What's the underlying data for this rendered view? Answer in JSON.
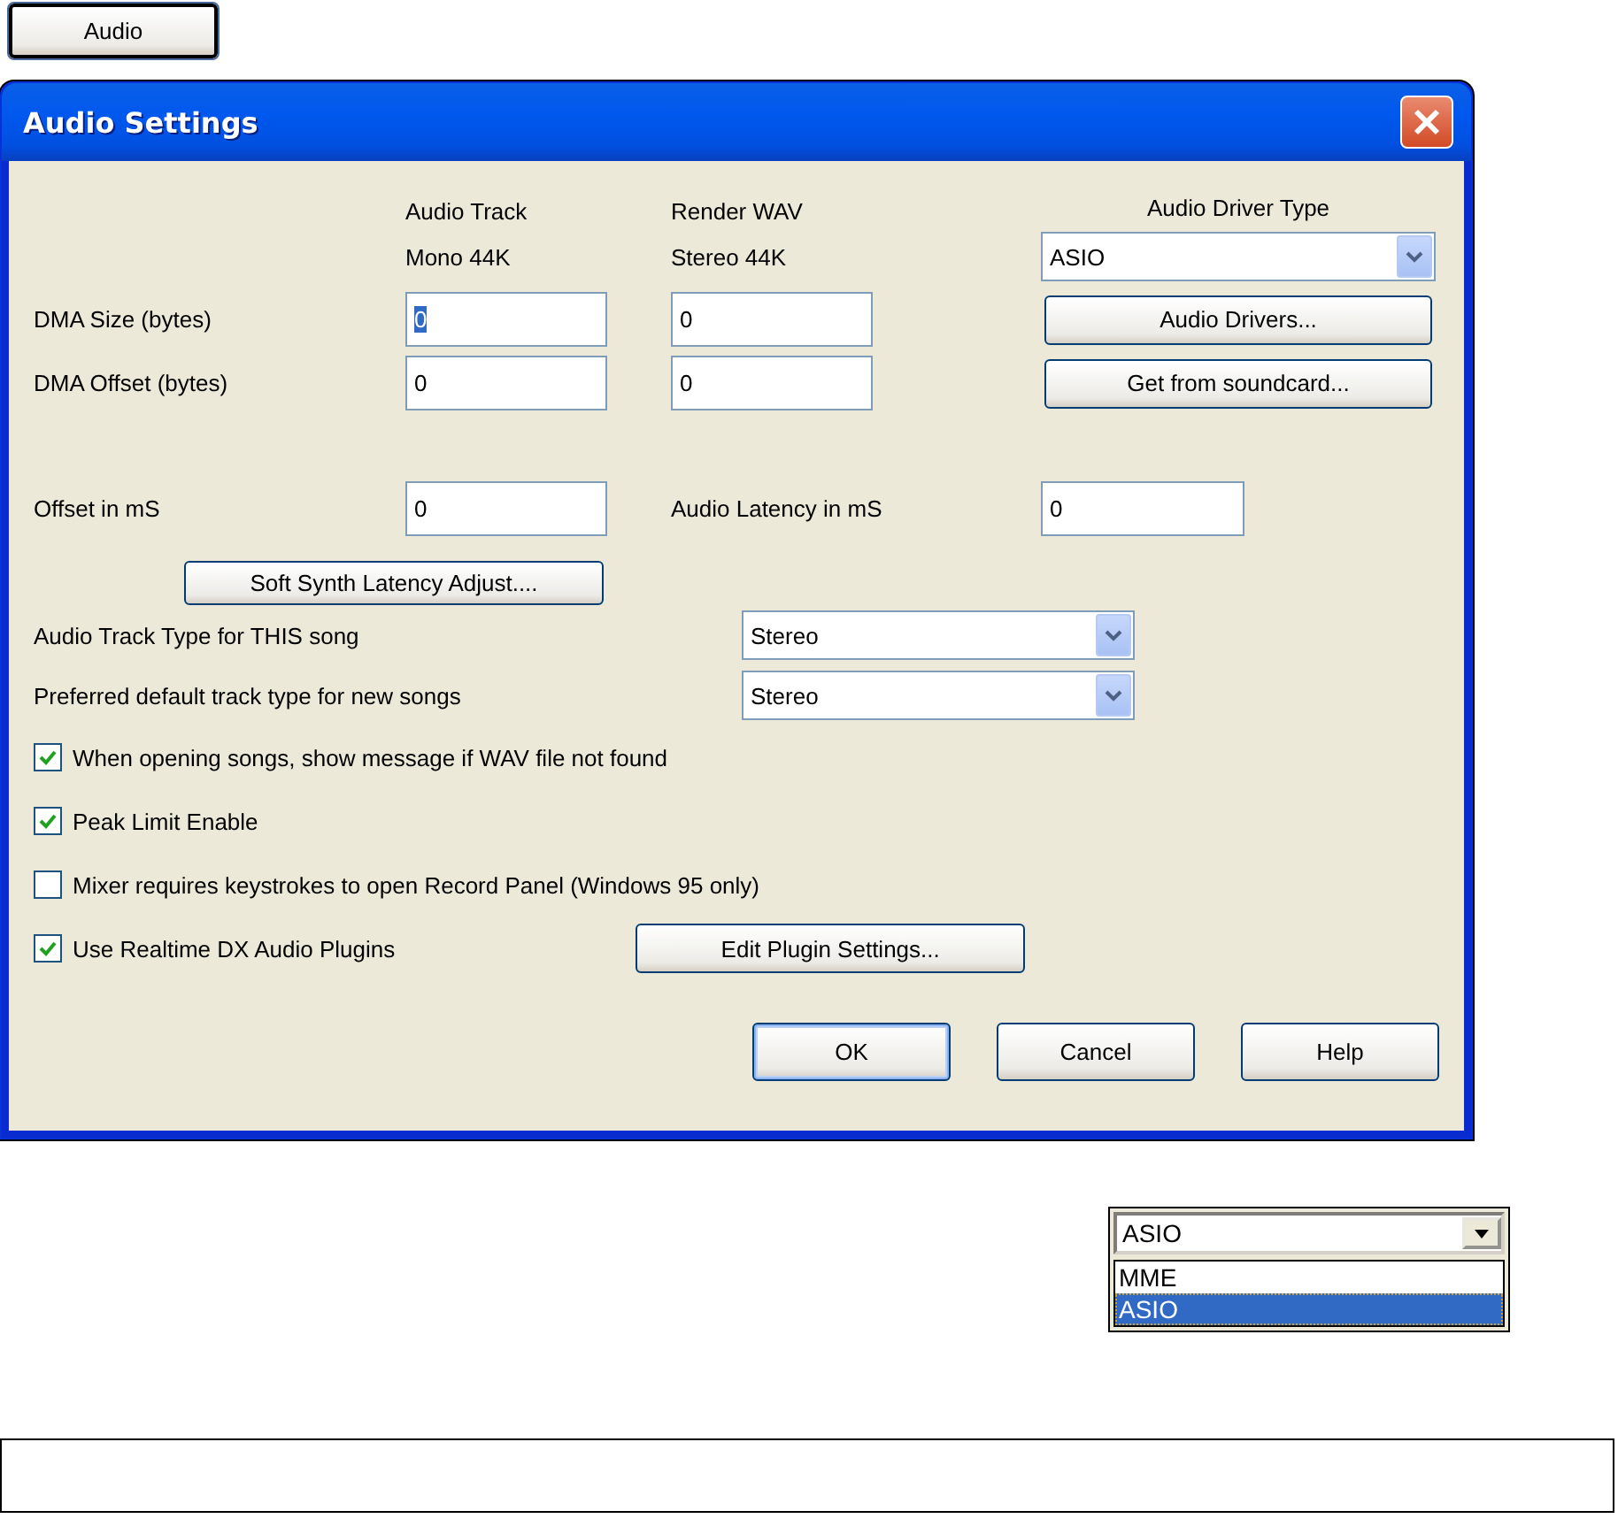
{
  "launcher_button": {
    "label": "Audio"
  },
  "window": {
    "title": "Audio Settings"
  },
  "column_headers": [
    {
      "line1": "Audio Track",
      "line2": "Mono 44K"
    },
    {
      "line1": "Render WAV",
      "line2": "Stereo 44K"
    }
  ],
  "driver": {
    "label": "Audio Driver Type",
    "value": "ASIO"
  },
  "driver_buttons": [
    "Audio Drivers...",
    "Get from soundcard..."
  ],
  "dma_rows": [
    {
      "label": "DMA Size (bytes)",
      "values": [
        {
          "value": "0",
          "selected": true
        },
        {
          "value": "0",
          "selected": false
        }
      ]
    },
    {
      "label": "DMA Offset (bytes)",
      "values": [
        {
          "value": "0",
          "selected": false
        },
        {
          "value": "0",
          "selected": false
        }
      ]
    }
  ],
  "offset": {
    "label": "Offset in mS",
    "value": "0"
  },
  "latency": {
    "label": "Audio Latency in mS",
    "value": "0"
  },
  "soft_synth_button": "Soft Synth Latency Adjust....",
  "track_types": [
    {
      "label": "Audio Track Type for THIS song",
      "value": "Stereo"
    },
    {
      "label": "Preferred default track type for new songs",
      "value": "Stereo"
    }
  ],
  "options": [
    {
      "label": "When opening songs, show message if WAV file not found",
      "checked": true
    },
    {
      "label": "Peak Limit Enable",
      "checked": true
    },
    {
      "label": "Mixer requires keystrokes to open Record Panel (Windows 95 only)",
      "checked": false
    },
    {
      "label": "Use Realtime DX Audio Plugins",
      "checked": true
    }
  ],
  "plugin_button": "Edit Plugin Settings...",
  "buttons": [
    {
      "label": "OK",
      "default": true
    },
    {
      "label": "Cancel",
      "default": false
    },
    {
      "label": "Help",
      "default": false
    }
  ],
  "driver_dropdown_example": {
    "value": "ASIO",
    "options": [
      {
        "label": "MME",
        "selected": false
      },
      {
        "label": "ASIO",
        "selected": true
      }
    ]
  }
}
